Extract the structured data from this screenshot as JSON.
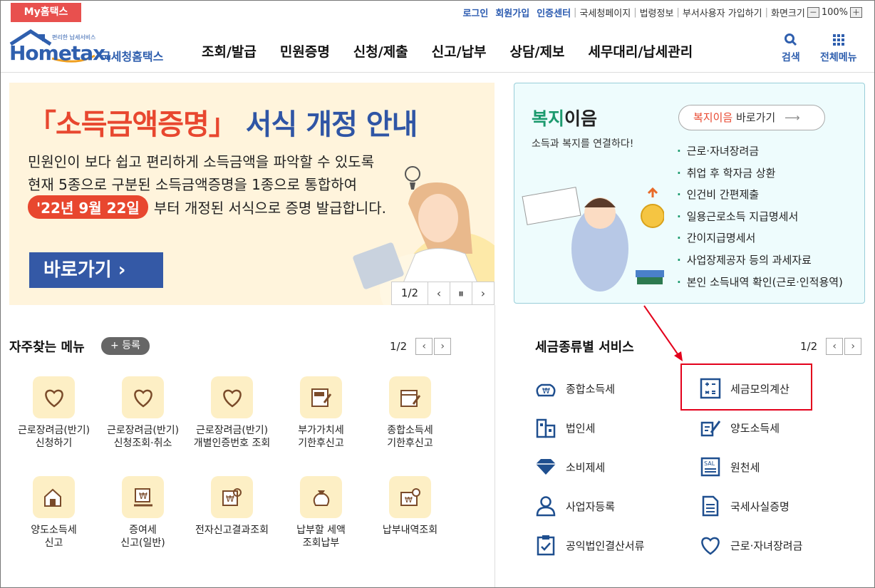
{
  "util": {
    "my": "My홈택스",
    "links": [
      "로그인",
      "회원가입",
      "인증센터"
    ],
    "plain": [
      "국세청페이지",
      "법령정보",
      "부서사용자 가입하기",
      "화면크기"
    ],
    "zoom": "100%",
    "minus": "－",
    "plus": "＋"
  },
  "logo": {
    "tag": "편리한 납세서비스",
    "name": "Hometax.",
    "kr": "국세청홈택스"
  },
  "nav": [
    "조회/발급",
    "민원증명",
    "신청/제출",
    "신고/납부",
    "상담/제보",
    "세무대리/납세관리"
  ],
  "tools": {
    "search": "검색",
    "all": "전체메뉴"
  },
  "banner": {
    "title_a": "「소득금액증명」",
    "title_b": "서식 개정 안내",
    "line1": "민원인이 보다 쉽고 편리하게 소득금액을 파악할 수 있도록",
    "line2": "현재 5종으로 구분된 소득금액증명을 1종으로 통합하여",
    "date": "'22년 9월 22일",
    "line3": "부터 개정된 서식으로 증명 발급합니다.",
    "go": "바로가기 ›",
    "page": "1/2"
  },
  "welfare": {
    "t1": "복지",
    "t2": "이음",
    "sub": "소득과 복지를 연결하다!",
    "go_a": "복지이음",
    "go_b": "바로가기",
    "items": [
      "근로·자녀장려금",
      "취업 후 학자금 상환",
      "인건비 간편제출",
      "일용근로소득 지급명세서",
      "간이지급명세서",
      "사업장제공자 등의 과세자료",
      "본인 소득내역 확인(근로·인적용역)"
    ]
  },
  "freq": {
    "title": "자주찾는 메뉴",
    "reg": "+ 등록",
    "page": "1/2",
    "items": [
      {
        "l1": "근로장려금(반기)",
        "l2": "신청하기"
      },
      {
        "l1": "근로장려금(반기)",
        "l2": "신청조회·취소"
      },
      {
        "l1": "근로장려금(반기)",
        "l2": "개별인증번호 조회"
      },
      {
        "l1": "부가가치세",
        "l2": "기한후신고"
      },
      {
        "l1": "종합소득세",
        "l2": "기한후신고"
      },
      {
        "l1": "양도소득세",
        "l2": "신고"
      },
      {
        "l1": "증여세",
        "l2": "신고(일반)"
      },
      {
        "l1": "전자신고결과조회",
        "l2": ""
      },
      {
        "l1": "납부할 세액",
        "l2": "조회납부"
      },
      {
        "l1": "납부내역조회",
        "l2": ""
      }
    ]
  },
  "tax": {
    "title": "세금종류별 서비스",
    "page": "1/2",
    "items": [
      "종합소득세",
      "세금모의계산",
      "법인세",
      "양도소득세",
      "소비제세",
      "원천세",
      "사업자등록",
      "국세사실증명",
      "공익법인결산서류",
      "근로·자녀장려금"
    ]
  }
}
